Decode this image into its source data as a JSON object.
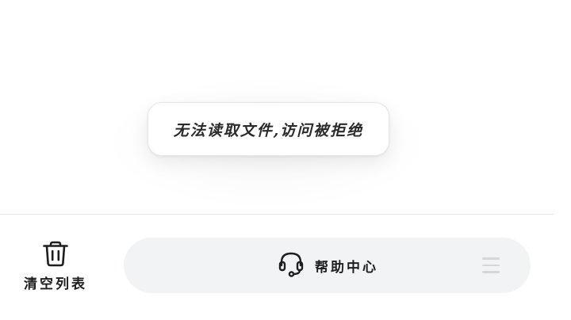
{
  "toast": {
    "message": "无法读取文件,访问被拒绝"
  },
  "bottom_bar": {
    "clear_list": {
      "label": "清空列表",
      "icon": "trash-icon"
    },
    "help_center": {
      "label": "帮助中心",
      "icon": "headset-icon"
    },
    "menu": {
      "icon": "menu-icon"
    }
  },
  "colors": {
    "background": "#ffffff",
    "pill_background": "#f2f3f5",
    "text": "#1e1e1e",
    "menu_icon": "#d4d6da"
  }
}
